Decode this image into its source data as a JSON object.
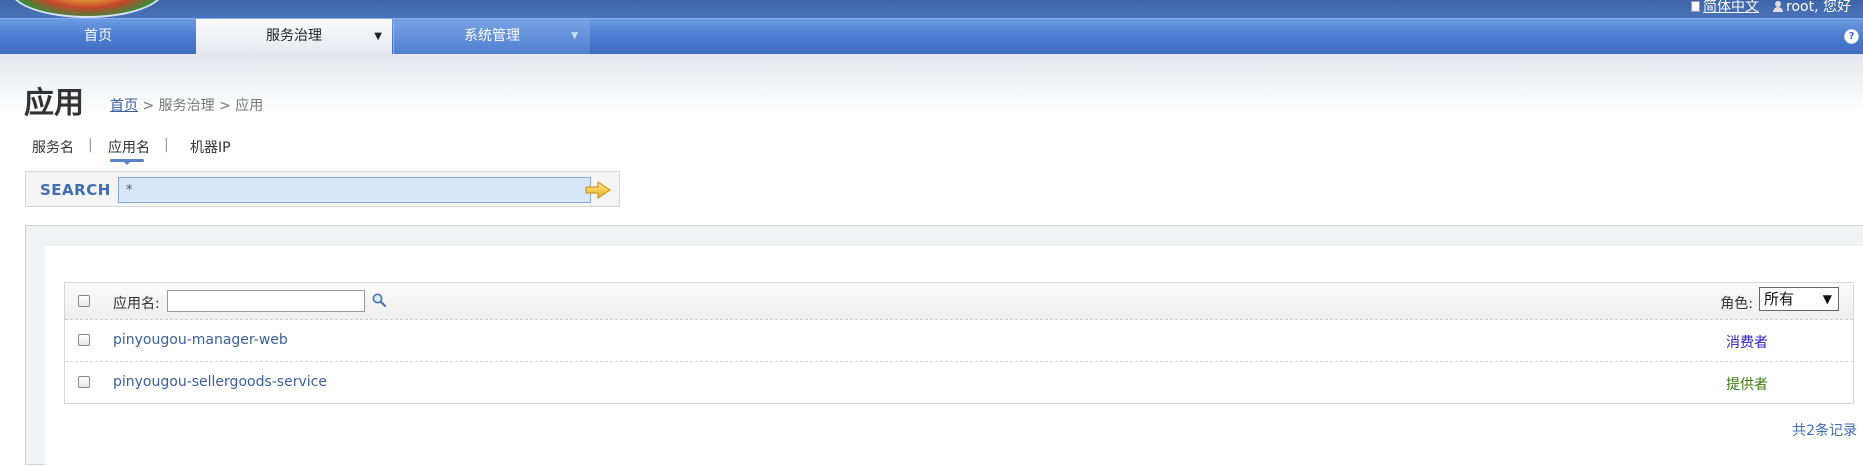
{
  "header": {
    "lang_link": "简体中文",
    "user_text": "root, 您好"
  },
  "nav": {
    "items": [
      {
        "label": "首页"
      },
      {
        "label": "服务治理"
      },
      {
        "label": "系统管理"
      }
    ],
    "help": "?"
  },
  "page": {
    "title": "应用",
    "breadcrumb": {
      "home": "首页",
      "rest": " > 服务治理 > 应用"
    }
  },
  "tabs": {
    "items": [
      {
        "label": "服务名"
      },
      {
        "label": "应用名",
        "active": true
      },
      {
        "label": "机器IP"
      }
    ],
    "separator": "|"
  },
  "search": {
    "label": "SEARCH",
    "value": "*"
  },
  "table": {
    "filter_label": "应用名:",
    "filter_value": "",
    "role_label": "角色:",
    "role_selected": "所有",
    "rows": [
      {
        "app": "pinyougou-manager-web",
        "role": "消费者"
      },
      {
        "app": "pinyougou-sellergoods-service",
        "role": "提供者"
      }
    ],
    "total": "共2条记录"
  },
  "colors": {
    "nav": "#4e7fd2",
    "link": "#3a5f9e",
    "consumer": "#2d1fc0",
    "provider": "#3d7a10"
  }
}
